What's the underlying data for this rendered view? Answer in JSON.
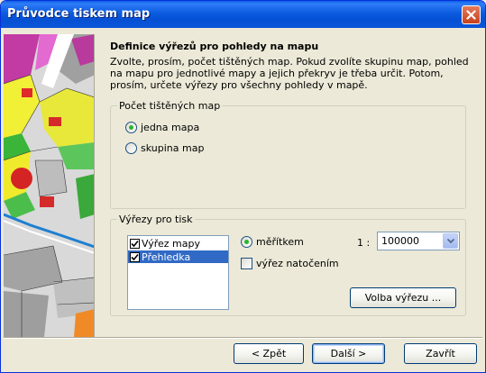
{
  "window": {
    "title": "Průvodce tiskem map"
  },
  "header": {
    "heading": "Definice výřezů pro pohledy na mapu",
    "description": "Zvolte, prosím, počet tištěných map. Pokud zvolíte skupinu map, pohled na mapu pro jednotlivé mapy a jejich překryv je třeba určit. Potom, prosím, určete výřezy pro všechny pohledy v mapě."
  },
  "map_count": {
    "legend": "Počet tištěných map",
    "options": [
      {
        "label": "jedna mapa",
        "selected": true
      },
      {
        "label": "skupina map",
        "selected": false
      }
    ]
  },
  "cutouts": {
    "legend": "Výřezy pro tisk",
    "list": [
      {
        "label": "Výřez mapy",
        "checked": true,
        "selected": false
      },
      {
        "label": "Přehledka",
        "checked": true,
        "selected": true
      }
    ],
    "scale_radio_label": "měřítkem",
    "scale_radio_selected": true,
    "scale_prefix": "1 :",
    "scale_value": "100000",
    "rotation_checkbox_label": "výřez natočením",
    "rotation_checked": false,
    "select_cutout_button": "Volba výřezu ..."
  },
  "footer": {
    "back_button": "< Zpět",
    "next_button": "Další >",
    "close_button": "Zavřít"
  },
  "colors": {
    "titlebar": "#0a55d8",
    "selection": "#316ac5",
    "dialog_bg": "#ece9d8",
    "radio_dot": "#2bb52b"
  }
}
